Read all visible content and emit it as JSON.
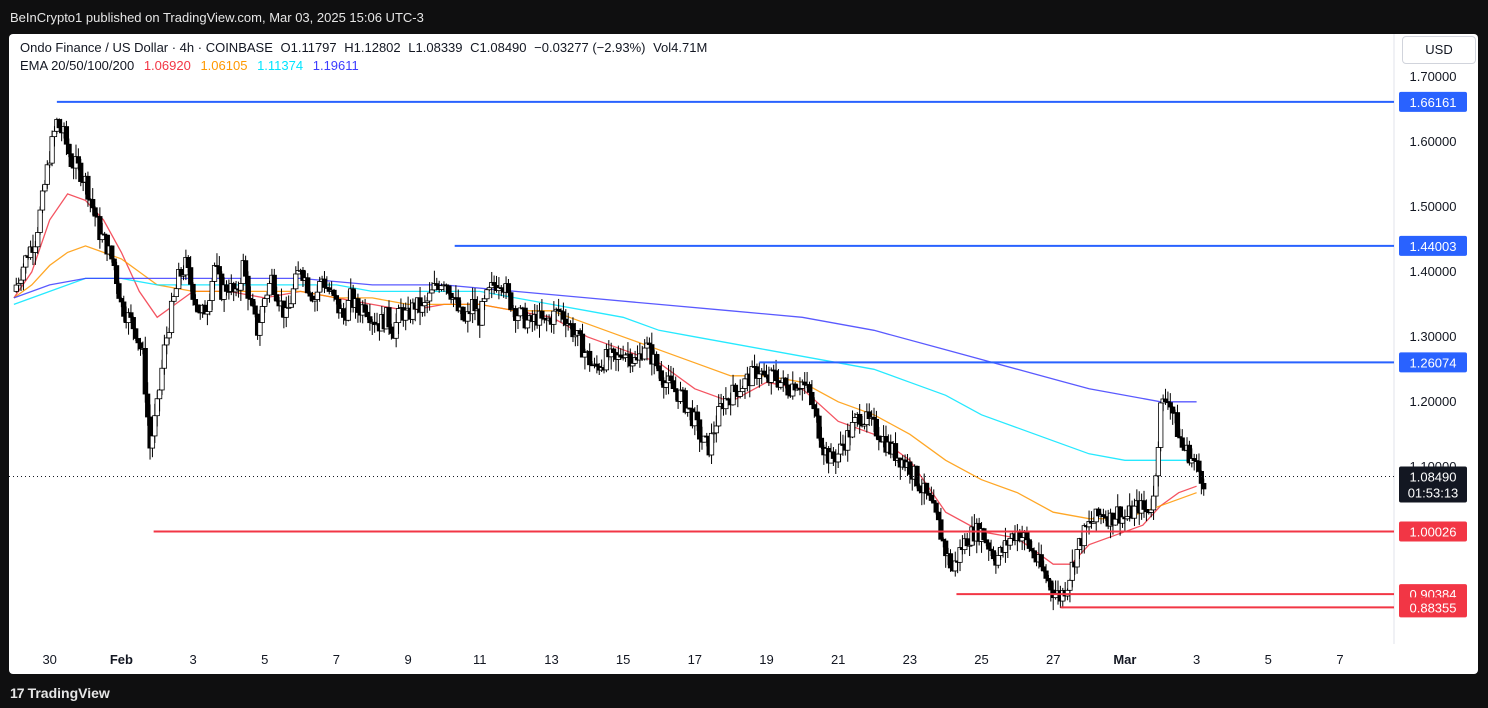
{
  "header": {
    "publisher": "BeInCrypto1 published on TradingView.com, Mar 03, 2025 15:06 UTC-3"
  },
  "legend": {
    "symbol": "Ondo Finance / US Dollar · 4h · COINBASE",
    "open": "O1.11797",
    "high": "H1.12802",
    "low": "L1.08339",
    "close": "C1.08490",
    "change": "−0.03277 (−2.93%)",
    "volume": "Vol4.71M",
    "ema_label": "EMA 20/50/100/200",
    "ema_values": [
      "1.06920",
      "1.06105",
      "1.11374",
      "1.19611"
    ],
    "ema_colors": [
      "#f23645",
      "#ff9800",
      "#00e5ff",
      "#3d3dff"
    ]
  },
  "currency_button": "USD",
  "footer": {
    "brand": "TradingView",
    "brand_mark": "17"
  },
  "colors": {
    "up": "#ffffff",
    "down": "#000000",
    "resistance": "#2962ff",
    "support": "#f23645",
    "axis_text": "#131722"
  },
  "chart_data": {
    "type": "candlestick",
    "title": "Ondo Finance / US Dollar",
    "timeframe": "4h",
    "exchange": "COINBASE",
    "x_tick_labels": [
      "30",
      "Feb",
      "3",
      "5",
      "7",
      "9",
      "11",
      "13",
      "15",
      "17",
      "19",
      "21",
      "23",
      "25",
      "27",
      "Mar",
      "3",
      "5",
      "7"
    ],
    "y_tick_labels": [
      "1.70000",
      "1.60000",
      "1.50000",
      "1.40000",
      "1.30000",
      "1.20000",
      "1.10000"
    ],
    "ylim": [
      0.83,
      1.72
    ],
    "current_price": "1.08490",
    "countdown": "01:53:13",
    "horizontal_levels": [
      {
        "value": 1.66161,
        "label": "1.66161",
        "kind": "resistance",
        "from_day": 0.2
      },
      {
        "value": 1.44003,
        "label": "1.44003",
        "kind": "resistance",
        "from_day": 11.3
      },
      {
        "value": 1.26074,
        "label": "1.26074",
        "kind": "resistance",
        "from_day": 19.8
      },
      {
        "value": 1.00026,
        "label": "1.00026",
        "kind": "support",
        "from_day": 2.9
      },
      {
        "value": 0.90384,
        "label": "0.90384",
        "kind": "support",
        "from_day": 25.3
      },
      {
        "value": 0.88355,
        "label": "0.88355",
        "kind": "support",
        "from_day": 28.2
      }
    ],
    "price_path": [
      [
        -1.0,
        1.37
      ],
      [
        -0.8,
        1.4
      ],
      [
        -0.6,
        1.43
      ],
      [
        -0.4,
        1.45
      ],
      [
        -0.2,
        1.51
      ],
      [
        0.0,
        1.58
      ],
      [
        0.2,
        1.63
      ],
      [
        0.4,
        1.61
      ],
      [
        0.6,
        1.57
      ],
      [
        0.8,
        1.56
      ],
      [
        1.0,
        1.54
      ],
      [
        1.2,
        1.5
      ],
      [
        1.4,
        1.46
      ],
      [
        1.6,
        1.44
      ],
      [
        1.8,
        1.41
      ],
      [
        2.0,
        1.35
      ],
      [
        2.2,
        1.33
      ],
      [
        2.4,
        1.31
      ],
      [
        2.6,
        1.27
      ],
      [
        2.8,
        1.13
      ],
      [
        3.0,
        1.19
      ],
      [
        3.2,
        1.28
      ],
      [
        3.4,
        1.34
      ],
      [
        3.6,
        1.39
      ],
      [
        3.8,
        1.41
      ],
      [
        4.0,
        1.37
      ],
      [
        4.2,
        1.33
      ],
      [
        4.4,
        1.35
      ],
      [
        4.6,
        1.41
      ],
      [
        4.8,
        1.37
      ],
      [
        5.0,
        1.38
      ],
      [
        5.2,
        1.36
      ],
      [
        5.4,
        1.41
      ],
      [
        5.6,
        1.35
      ],
      [
        5.8,
        1.31
      ],
      [
        6.0,
        1.36
      ],
      [
        6.2,
        1.39
      ],
      [
        6.4,
        1.36
      ],
      [
        6.6,
        1.33
      ],
      [
        6.8,
        1.37
      ],
      [
        7.0,
        1.41
      ],
      [
        7.2,
        1.38
      ],
      [
        7.4,
        1.36
      ],
      [
        7.6,
        1.39
      ],
      [
        7.8,
        1.37
      ],
      [
        8.0,
        1.35
      ],
      [
        8.2,
        1.33
      ],
      [
        8.4,
        1.36
      ],
      [
        8.6,
        1.34
      ],
      [
        8.8,
        1.35
      ],
      [
        9.0,
        1.33
      ],
      [
        9.2,
        1.32
      ],
      [
        9.4,
        1.33
      ],
      [
        9.6,
        1.31
      ],
      [
        9.8,
        1.34
      ],
      [
        10.0,
        1.33
      ],
      [
        10.2,
        1.35
      ],
      [
        10.4,
        1.34
      ],
      [
        10.6,
        1.36
      ],
      [
        10.8,
        1.38
      ],
      [
        11.0,
        1.39
      ],
      [
        11.2,
        1.37
      ],
      [
        11.4,
        1.34
      ],
      [
        11.6,
        1.32
      ],
      [
        11.8,
        1.35
      ],
      [
        12.0,
        1.33
      ],
      [
        12.2,
        1.36
      ],
      [
        12.4,
        1.38
      ],
      [
        12.6,
        1.39
      ],
      [
        12.8,
        1.36
      ],
      [
        13.0,
        1.34
      ],
      [
        13.2,
        1.33
      ],
      [
        13.4,
        1.32
      ],
      [
        13.6,
        1.33
      ],
      [
        13.8,
        1.32
      ],
      [
        14.0,
        1.33
      ],
      [
        14.2,
        1.34
      ],
      [
        14.4,
        1.33
      ],
      [
        14.6,
        1.31
      ],
      [
        14.8,
        1.29
      ],
      [
        15.0,
        1.27
      ],
      [
        15.2,
        1.25
      ],
      [
        15.4,
        1.26
      ],
      [
        15.6,
        1.27
      ],
      [
        15.8,
        1.26
      ],
      [
        16.0,
        1.28
      ],
      [
        16.2,
        1.27
      ],
      [
        16.4,
        1.26
      ],
      [
        16.6,
        1.29
      ],
      [
        16.8,
        1.27
      ],
      [
        17.0,
        1.25
      ],
      [
        17.2,
        1.23
      ],
      [
        17.4,
        1.22
      ],
      [
        17.6,
        1.21
      ],
      [
        17.8,
        1.19
      ],
      [
        18.0,
        1.17
      ],
      [
        18.2,
        1.14
      ],
      [
        18.4,
        1.13
      ],
      [
        18.6,
        1.17
      ],
      [
        18.8,
        1.2
      ],
      [
        19.0,
        1.21
      ],
      [
        19.2,
        1.22
      ],
      [
        19.4,
        1.23
      ],
      [
        19.6,
        1.24
      ],
      [
        19.8,
        1.25
      ],
      [
        20.0,
        1.23
      ],
      [
        20.2,
        1.24
      ],
      [
        20.4,
        1.23
      ],
      [
        20.6,
        1.22
      ],
      [
        20.8,
        1.23
      ],
      [
        21.0,
        1.23
      ],
      [
        21.2,
        1.21
      ],
      [
        21.4,
        1.17
      ],
      [
        21.6,
        1.13
      ],
      [
        21.8,
        1.11
      ],
      [
        22.0,
        1.12
      ],
      [
        22.2,
        1.14
      ],
      [
        22.4,
        1.16
      ],
      [
        22.6,
        1.18
      ],
      [
        22.8,
        1.17
      ],
      [
        23.0,
        1.16
      ],
      [
        23.2,
        1.15
      ],
      [
        23.4,
        1.13
      ],
      [
        23.6,
        1.12
      ],
      [
        23.8,
        1.11
      ],
      [
        24.0,
        1.1
      ],
      [
        24.2,
        1.08
      ],
      [
        24.4,
        1.06
      ],
      [
        24.6,
        1.04
      ],
      [
        24.8,
        1.01
      ],
      [
        25.0,
        0.97
      ],
      [
        25.2,
        0.94
      ],
      [
        25.4,
        0.97
      ],
      [
        25.6,
        0.99
      ],
      [
        25.8,
        1.0
      ],
      [
        26.0,
        1.0
      ],
      [
        26.2,
        0.98
      ],
      [
        26.4,
        0.96
      ],
      [
        26.6,
        0.97
      ],
      [
        26.8,
        0.99
      ],
      [
        27.0,
        1.0
      ],
      [
        27.2,
        0.99
      ],
      [
        27.4,
        0.97
      ],
      [
        27.6,
        0.95
      ],
      [
        27.8,
        0.93
      ],
      [
        28.0,
        0.91
      ],
      [
        28.2,
        0.9
      ],
      [
        28.4,
        0.92
      ],
      [
        28.6,
        0.96
      ],
      [
        28.8,
        0.99
      ],
      [
        29.0,
        1.01
      ],
      [
        29.2,
        1.02
      ],
      [
        29.4,
        1.03
      ],
      [
        29.6,
        1.02
      ],
      [
        29.8,
        1.03
      ],
      [
        30.0,
        1.02
      ],
      [
        30.2,
        1.03
      ],
      [
        30.4,
        1.04
      ],
      [
        30.6,
        1.03
      ],
      [
        30.8,
        1.05
      ],
      [
        31.0,
        1.19
      ],
      [
        31.2,
        1.21
      ],
      [
        31.4,
        1.17
      ],
      [
        31.6,
        1.13
      ],
      [
        31.8,
        1.12
      ],
      [
        32.0,
        1.1
      ],
      [
        32.2,
        1.08
      ]
    ],
    "ema_series": [
      {
        "name": "EMA 20",
        "color": "#f23645",
        "values": [
          [
            -1.0,
            1.36
          ],
          [
            -0.5,
            1.4
          ],
          [
            0.0,
            1.48
          ],
          [
            0.5,
            1.52
          ],
          [
            1.0,
            1.51
          ],
          [
            1.5,
            1.48
          ],
          [
            2.0,
            1.43
          ],
          [
            2.5,
            1.37
          ],
          [
            3.0,
            1.33
          ],
          [
            3.5,
            1.35
          ],
          [
            4.0,
            1.37
          ],
          [
            5.0,
            1.37
          ],
          [
            6.0,
            1.36
          ],
          [
            7.0,
            1.37
          ],
          [
            8.0,
            1.36
          ],
          [
            9.0,
            1.35
          ],
          [
            10.0,
            1.34
          ],
          [
            11.0,
            1.35
          ],
          [
            12.0,
            1.35
          ],
          [
            13.0,
            1.34
          ],
          [
            14.0,
            1.33
          ],
          [
            15.0,
            1.3
          ],
          [
            16.0,
            1.28
          ],
          [
            17.0,
            1.26
          ],
          [
            18.0,
            1.22
          ],
          [
            19.0,
            1.2
          ],
          [
            20.0,
            1.23
          ],
          [
            21.0,
            1.22
          ],
          [
            22.0,
            1.17
          ],
          [
            23.0,
            1.15
          ],
          [
            24.0,
            1.11
          ],
          [
            25.0,
            1.03
          ],
          [
            26.0,
            1.0
          ],
          [
            27.0,
            0.99
          ],
          [
            28.0,
            0.95
          ],
          [
            28.5,
            0.95
          ],
          [
            29.0,
            0.98
          ],
          [
            30.0,
            1.0
          ],
          [
            30.5,
            1.01
          ],
          [
            31.0,
            1.04
          ],
          [
            31.5,
            1.06
          ],
          [
            32.0,
            1.07
          ]
        ]
      },
      {
        "name": "EMA 50",
        "color": "#ff9800",
        "values": [
          [
            -1.0,
            1.36
          ],
          [
            -0.5,
            1.38
          ],
          [
            0.0,
            1.41
          ],
          [
            0.5,
            1.43
          ],
          [
            1.0,
            1.44
          ],
          [
            1.5,
            1.43
          ],
          [
            2.0,
            1.42
          ],
          [
            2.5,
            1.4
          ],
          [
            3.0,
            1.38
          ],
          [
            4.0,
            1.37
          ],
          [
            5.0,
            1.37
          ],
          [
            6.0,
            1.37
          ],
          [
            7.0,
            1.37
          ],
          [
            8.0,
            1.36
          ],
          [
            9.0,
            1.36
          ],
          [
            10.0,
            1.35
          ],
          [
            11.0,
            1.35
          ],
          [
            12.0,
            1.35
          ],
          [
            13.0,
            1.34
          ],
          [
            14.0,
            1.34
          ],
          [
            15.0,
            1.32
          ],
          [
            16.0,
            1.3
          ],
          [
            17.0,
            1.28
          ],
          [
            18.0,
            1.26
          ],
          [
            19.0,
            1.24
          ],
          [
            20.0,
            1.24
          ],
          [
            21.0,
            1.23
          ],
          [
            22.0,
            1.2
          ],
          [
            23.0,
            1.18
          ],
          [
            24.0,
            1.15
          ],
          [
            25.0,
            1.11
          ],
          [
            26.0,
            1.08
          ],
          [
            27.0,
            1.06
          ],
          [
            28.0,
            1.03
          ],
          [
            29.0,
            1.02
          ],
          [
            30.0,
            1.02
          ],
          [
            31.0,
            1.04
          ],
          [
            31.5,
            1.05
          ],
          [
            32.0,
            1.06
          ]
        ]
      },
      {
        "name": "EMA 100",
        "color": "#00e5ff",
        "values": [
          [
            -1.0,
            1.35
          ],
          [
            0.0,
            1.37
          ],
          [
            1.0,
            1.39
          ],
          [
            2.0,
            1.39
          ],
          [
            3.0,
            1.38
          ],
          [
            4.0,
            1.38
          ],
          [
            5.0,
            1.38
          ],
          [
            6.0,
            1.38
          ],
          [
            7.0,
            1.38
          ],
          [
            8.0,
            1.38
          ],
          [
            9.0,
            1.37
          ],
          [
            10.0,
            1.37
          ],
          [
            11.0,
            1.37
          ],
          [
            12.0,
            1.37
          ],
          [
            13.0,
            1.36
          ],
          [
            14.0,
            1.35
          ],
          [
            15.0,
            1.34
          ],
          [
            16.0,
            1.33
          ],
          [
            17.0,
            1.31
          ],
          [
            18.0,
            1.3
          ],
          [
            19.0,
            1.29
          ],
          [
            20.0,
            1.28
          ],
          [
            21.0,
            1.27
          ],
          [
            22.0,
            1.26
          ],
          [
            23.0,
            1.25
          ],
          [
            24.0,
            1.23
          ],
          [
            25.0,
            1.21
          ],
          [
            26.0,
            1.18
          ],
          [
            27.0,
            1.16
          ],
          [
            28.0,
            1.14
          ],
          [
            29.0,
            1.12
          ],
          [
            30.0,
            1.11
          ],
          [
            31.0,
            1.11
          ],
          [
            32.0,
            1.11
          ]
        ]
      },
      {
        "name": "EMA 200",
        "color": "#3d3dff",
        "values": [
          [
            -1.0,
            1.36
          ],
          [
            0.0,
            1.38
          ],
          [
            1.0,
            1.39
          ],
          [
            2.0,
            1.39
          ],
          [
            3.0,
            1.39
          ],
          [
            5.0,
            1.39
          ],
          [
            7.0,
            1.39
          ],
          [
            9.0,
            1.38
          ],
          [
            11.0,
            1.38
          ],
          [
            13.0,
            1.37
          ],
          [
            15.0,
            1.36
          ],
          [
            17.0,
            1.35
          ],
          [
            19.0,
            1.34
          ],
          [
            21.0,
            1.33
          ],
          [
            23.0,
            1.31
          ],
          [
            25.0,
            1.28
          ],
          [
            27.0,
            1.25
          ],
          [
            29.0,
            1.22
          ],
          [
            31.0,
            1.2
          ],
          [
            32.0,
            1.2
          ]
        ]
      }
    ]
  }
}
